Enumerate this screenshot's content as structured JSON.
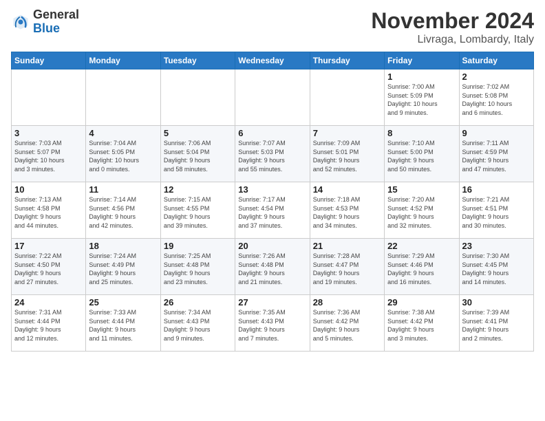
{
  "header": {
    "logo_line1": "General",
    "logo_line2": "Blue",
    "month": "November 2024",
    "location": "Livraga, Lombardy, Italy"
  },
  "days_of_week": [
    "Sunday",
    "Monday",
    "Tuesday",
    "Wednesday",
    "Thursday",
    "Friday",
    "Saturday"
  ],
  "weeks": [
    [
      {
        "day": "",
        "info": ""
      },
      {
        "day": "",
        "info": ""
      },
      {
        "day": "",
        "info": ""
      },
      {
        "day": "",
        "info": ""
      },
      {
        "day": "",
        "info": ""
      },
      {
        "day": "1",
        "info": "Sunrise: 7:00 AM\nSunset: 5:09 PM\nDaylight: 10 hours\nand 9 minutes."
      },
      {
        "day": "2",
        "info": "Sunrise: 7:02 AM\nSunset: 5:08 PM\nDaylight: 10 hours\nand 6 minutes."
      }
    ],
    [
      {
        "day": "3",
        "info": "Sunrise: 7:03 AM\nSunset: 5:07 PM\nDaylight: 10 hours\nand 3 minutes."
      },
      {
        "day": "4",
        "info": "Sunrise: 7:04 AM\nSunset: 5:05 PM\nDaylight: 10 hours\nand 0 minutes."
      },
      {
        "day": "5",
        "info": "Sunrise: 7:06 AM\nSunset: 5:04 PM\nDaylight: 9 hours\nand 58 minutes."
      },
      {
        "day": "6",
        "info": "Sunrise: 7:07 AM\nSunset: 5:03 PM\nDaylight: 9 hours\nand 55 minutes."
      },
      {
        "day": "7",
        "info": "Sunrise: 7:09 AM\nSunset: 5:01 PM\nDaylight: 9 hours\nand 52 minutes."
      },
      {
        "day": "8",
        "info": "Sunrise: 7:10 AM\nSunset: 5:00 PM\nDaylight: 9 hours\nand 50 minutes."
      },
      {
        "day": "9",
        "info": "Sunrise: 7:11 AM\nSunset: 4:59 PM\nDaylight: 9 hours\nand 47 minutes."
      }
    ],
    [
      {
        "day": "10",
        "info": "Sunrise: 7:13 AM\nSunset: 4:58 PM\nDaylight: 9 hours\nand 44 minutes."
      },
      {
        "day": "11",
        "info": "Sunrise: 7:14 AM\nSunset: 4:56 PM\nDaylight: 9 hours\nand 42 minutes."
      },
      {
        "day": "12",
        "info": "Sunrise: 7:15 AM\nSunset: 4:55 PM\nDaylight: 9 hours\nand 39 minutes."
      },
      {
        "day": "13",
        "info": "Sunrise: 7:17 AM\nSunset: 4:54 PM\nDaylight: 9 hours\nand 37 minutes."
      },
      {
        "day": "14",
        "info": "Sunrise: 7:18 AM\nSunset: 4:53 PM\nDaylight: 9 hours\nand 34 minutes."
      },
      {
        "day": "15",
        "info": "Sunrise: 7:20 AM\nSunset: 4:52 PM\nDaylight: 9 hours\nand 32 minutes."
      },
      {
        "day": "16",
        "info": "Sunrise: 7:21 AM\nSunset: 4:51 PM\nDaylight: 9 hours\nand 30 minutes."
      }
    ],
    [
      {
        "day": "17",
        "info": "Sunrise: 7:22 AM\nSunset: 4:50 PM\nDaylight: 9 hours\nand 27 minutes."
      },
      {
        "day": "18",
        "info": "Sunrise: 7:24 AM\nSunset: 4:49 PM\nDaylight: 9 hours\nand 25 minutes."
      },
      {
        "day": "19",
        "info": "Sunrise: 7:25 AM\nSunset: 4:48 PM\nDaylight: 9 hours\nand 23 minutes."
      },
      {
        "day": "20",
        "info": "Sunrise: 7:26 AM\nSunset: 4:48 PM\nDaylight: 9 hours\nand 21 minutes."
      },
      {
        "day": "21",
        "info": "Sunrise: 7:28 AM\nSunset: 4:47 PM\nDaylight: 9 hours\nand 19 minutes."
      },
      {
        "day": "22",
        "info": "Sunrise: 7:29 AM\nSunset: 4:46 PM\nDaylight: 9 hours\nand 16 minutes."
      },
      {
        "day": "23",
        "info": "Sunrise: 7:30 AM\nSunset: 4:45 PM\nDaylight: 9 hours\nand 14 minutes."
      }
    ],
    [
      {
        "day": "24",
        "info": "Sunrise: 7:31 AM\nSunset: 4:44 PM\nDaylight: 9 hours\nand 12 minutes."
      },
      {
        "day": "25",
        "info": "Sunrise: 7:33 AM\nSunset: 4:44 PM\nDaylight: 9 hours\nand 11 minutes."
      },
      {
        "day": "26",
        "info": "Sunrise: 7:34 AM\nSunset: 4:43 PM\nDaylight: 9 hours\nand 9 minutes."
      },
      {
        "day": "27",
        "info": "Sunrise: 7:35 AM\nSunset: 4:43 PM\nDaylight: 9 hours\nand 7 minutes."
      },
      {
        "day": "28",
        "info": "Sunrise: 7:36 AM\nSunset: 4:42 PM\nDaylight: 9 hours\nand 5 minutes."
      },
      {
        "day": "29",
        "info": "Sunrise: 7:38 AM\nSunset: 4:42 PM\nDaylight: 9 hours\nand 3 minutes."
      },
      {
        "day": "30",
        "info": "Sunrise: 7:39 AM\nSunset: 4:41 PM\nDaylight: 9 hours\nand 2 minutes."
      }
    ]
  ]
}
